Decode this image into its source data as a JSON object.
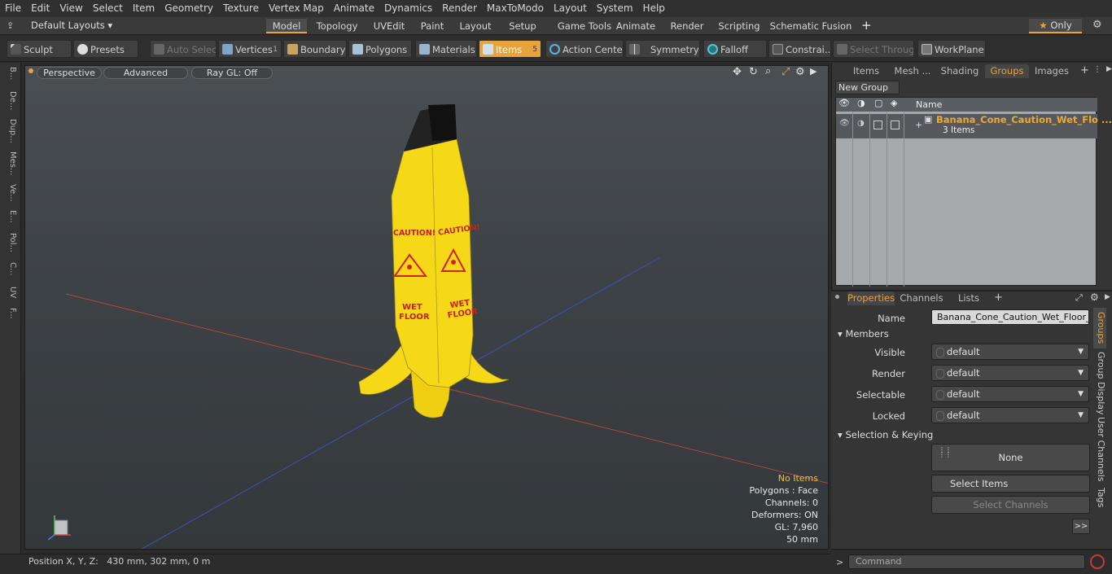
{
  "menu": [
    "File",
    "Edit",
    "View",
    "Select",
    "Item",
    "Geometry",
    "Texture",
    "Vertex Map",
    "Animate",
    "Dynamics",
    "Render",
    "MaxToModo",
    "Layout",
    "System",
    "Help"
  ],
  "layout_selector": "Default Layouts",
  "mode_tabs": [
    "Model",
    "Topology",
    "UVEdit",
    "Paint",
    "Layout",
    "Setup",
    "Game Tools",
    "Animate",
    "Render",
    "Scripting",
    "Schematic Fusion"
  ],
  "only_label": "Only",
  "toolbar": {
    "sculpt": "Sculpt",
    "presets": "Presets",
    "auto_select": "Auto Select",
    "vertices": "Vertices",
    "vertices_count": "1",
    "boundary": "Boundary",
    "polygons": "Polygons",
    "materials": "Materials",
    "items": "Items",
    "items_count": "5",
    "action_center": "Action Center",
    "symmetry": "Symmetry",
    "falloff": "Falloff",
    "constraints": "Constrai...",
    "select_through": "Select Through",
    "workplane": "WorkPlane"
  },
  "left_tabs": [
    "B...",
    "De...",
    "Dup...",
    "Mes...",
    "Ve...",
    "E...",
    "Pol...",
    "C...",
    "UV",
    "F..."
  ],
  "viewport": {
    "perspective": "Perspective",
    "advanced": "Advanced",
    "raygl": "Ray GL: Off",
    "sign_caution": "CAUTION!",
    "sign_wet": "WET",
    "sign_floor": "FLOOR",
    "hud": {
      "no_items": "No Items",
      "polygons": "Polygons : Face",
      "channels": "Channels: 0",
      "deformers": "Deformers: ON",
      "gl": "GL: 7,960",
      "scale": "50 mm"
    }
  },
  "status": {
    "label": "Position X, Y, Z:",
    "value": "430 mm, 302 mm, 0 m"
  },
  "right_top_tabs": [
    "Items",
    "Mesh ...",
    "Shading",
    "Groups",
    "Images"
  ],
  "new_group": "New Group",
  "group_list": {
    "column_name": "Name",
    "group_name": "Banana_Cone_Caution_Wet_Flo ...",
    "group_count": "3 Items"
  },
  "props_tabs": [
    "Properties",
    "Channels",
    "Lists"
  ],
  "properties": {
    "name_label": "Name",
    "name_value": "Banana_Cone_Caution_Wet_Floor_Si",
    "members": "Members",
    "visible_label": "Visible",
    "visible_value": "default",
    "render_label": "Render",
    "render_value": "default",
    "selectable_label": "Selectable",
    "selectable_value": "default",
    "locked_label": "Locked",
    "locked_value": "default",
    "sel_keying": "Selection & Keying",
    "none": "None",
    "select_items": "Select Items",
    "select_channels": "Select Channels",
    "more": ">>"
  },
  "side_vtabs": [
    "Groups",
    "Group Display",
    "User Channels",
    "Tags"
  ],
  "command_placeholder": "Command",
  "colors": {
    "accent": "#e8a33d",
    "banana": "#f5d817"
  }
}
